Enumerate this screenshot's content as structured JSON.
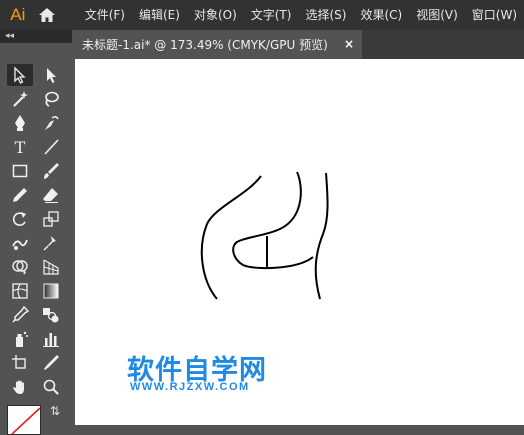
{
  "app": {
    "logo": "Ai"
  },
  "menu": {
    "items": [
      "文件(F)",
      "编辑(E)",
      "对象(O)",
      "文字(T)",
      "选择(S)",
      "效果(C)",
      "视图(V)",
      "窗口(W)"
    ]
  },
  "document_tab": {
    "title": "未标题-1.ai* @ 173.49% (CMYK/GPU 预览)",
    "close": "×"
  },
  "toolbar": {
    "collapse": "◂◂",
    "tools": [
      "selection-tool-icon",
      "direct-selection-tool-icon",
      "magic-wand-tool-icon",
      "lasso-tool-icon",
      "pen-tool-icon",
      "curvature-tool-icon",
      "type-tool-icon",
      "line-segment-tool-icon",
      "rectangle-tool-icon",
      "paintbrush-tool-icon",
      "pencil-tool-icon",
      "eraser-tool-icon",
      "rotate-tool-icon",
      "scale-tool-icon",
      "warp-tool-icon",
      "puppet-warp-tool-icon",
      "shape-builder-tool-icon",
      "perspective-grid-tool-icon",
      "mesh-tool-icon",
      "gradient-tool-icon",
      "eyedropper-tool-icon",
      "blend-tool-icon",
      "symbol-sprayer-tool-icon",
      "column-graph-tool-icon",
      "artboard-tool-icon",
      "slice-tool-icon",
      "hand-tool-icon",
      "zoom-tool-icon"
    ],
    "type_glyph": "T"
  },
  "canvas": {
    "watermark_title": "软件自学网",
    "watermark_url": "WWW.RJZXW.COM"
  },
  "colors": {
    "menubar": "#323232",
    "panel": "#535353",
    "accent_logo": "#FF9A00",
    "watermark": "#1f8ae6"
  }
}
